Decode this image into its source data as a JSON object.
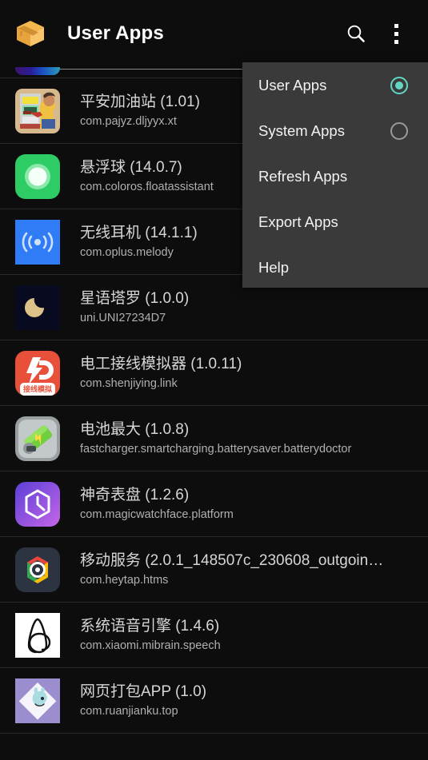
{
  "appbar": {
    "icon": "package-box-icon",
    "title": "User Apps",
    "search_icon": "search-icon",
    "overflow_icon": "overflow-menu-icon"
  },
  "menu": {
    "items": [
      {
        "label": "User Apps",
        "type": "radio",
        "selected": true,
        "name": "menu-item-user-apps"
      },
      {
        "label": "System Apps",
        "type": "radio",
        "selected": false,
        "name": "menu-item-system-apps"
      },
      {
        "label": "Refresh Apps",
        "type": "action",
        "name": "menu-item-refresh-apps"
      },
      {
        "label": "Export Apps",
        "type": "action",
        "name": "menu-item-export-apps"
      },
      {
        "label": "Help",
        "type": "action",
        "name": "menu-item-help"
      }
    ],
    "selected_color": "#62d6c4",
    "unselected_color": "#9a9a9a",
    "background": "#3a3a3a"
  },
  "list": {
    "partial_top_row": {
      "icon": "gradient-app-icon-cutoff"
    },
    "apps": [
      {
        "name": "平安加油站 (1.01)",
        "package": "com.pajyz.dljyyx.xt",
        "icon": "gas-station-game-icon"
      },
      {
        "name": "悬浮球 (14.0.7)",
        "package": "com.coloros.floatassistant",
        "icon": "float-ball-icon"
      },
      {
        "name": "无线耳机 (14.1.1)",
        "package": "com.oplus.melody",
        "icon": "wireless-earphone-icon"
      },
      {
        "name": "星语塔罗 (1.0.0)",
        "package": "uni.UNI27234D7",
        "icon": "moon-tarot-icon"
      },
      {
        "name": "电工接线模拟器 (1.0.11)",
        "package": "com.shenjiying.link",
        "icon": "electrician-sim-icon"
      },
      {
        "name": "电池最大 (1.0.8)",
        "package": "fastcharger.smartcharging.batterysaver.batterydoctor",
        "icon": "battery-max-icon"
      },
      {
        "name": "神奇表盘 (1.2.6)",
        "package": "com.magicwatchface.platform",
        "icon": "magic-watchface-icon"
      },
      {
        "name": "移动服务 (2.0.1_148507c_230608_outgoin…",
        "package": "com.heytap.htms",
        "icon": "heytap-service-icon"
      },
      {
        "name": "系统语音引擎 (1.4.6)",
        "package": "com.xiaomi.mibrain.speech",
        "icon": "xiaomi-speech-icon"
      },
      {
        "name": "网页打包APP (1.0)",
        "package": "com.ruanjianku.top",
        "icon": "webpack-app-icon"
      }
    ]
  },
  "colors": {
    "background": "#0d0d0d",
    "divider": "#2a2a2a",
    "primary_text": "#d6d6d6",
    "secondary_text": "#b0b0b0",
    "title_text": "#ffffff"
  }
}
